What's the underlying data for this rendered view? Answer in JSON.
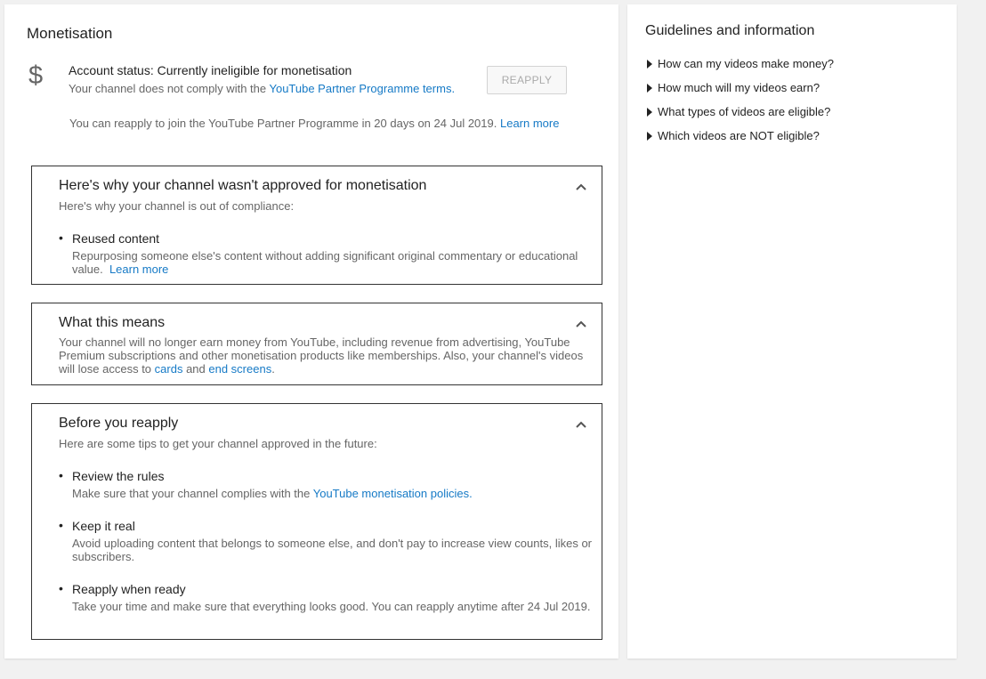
{
  "page": {
    "title": "Monetisation"
  },
  "status": {
    "icon": "dollar-icon",
    "icon_glyph": "$",
    "line": "Account status: Currently ineligible for monetisation",
    "sub_prefix": "Your channel does not comply with the ",
    "sub_link": "YouTube Partner Programme terms.",
    "reapply_label": "REAPPLY",
    "note_prefix": "You can reapply to join the YouTube Partner Programme in 20 days on 24 Jul 2019. ",
    "note_link": "Learn more"
  },
  "why": {
    "heading": "Here's why your channel wasn't approved for monetisation",
    "sub": "Here's why your channel is out of compliance:",
    "item_title": "Reused content",
    "item_desc": "Repurposing someone else's content without adding significant original commentary or educational value.",
    "item_link": "Learn more"
  },
  "means": {
    "heading": "What this means",
    "body_prefix": "Your channel will no longer earn money from YouTube, including revenue from advertising, YouTube Premium subscriptions and other monetisation products like memberships. Also, your channel's videos will lose access to ",
    "link_cards": "cards",
    "body_and": " and ",
    "link_end_screens": "end screens",
    "body_suffix": "."
  },
  "before": {
    "heading": "Before you reapply",
    "sub": "Here are some tips to get your channel approved in the future:",
    "items": [
      {
        "title": "Review the rules",
        "desc_prefix": "Make sure that your channel complies with the ",
        "desc_link": "YouTube monetisation policies."
      },
      {
        "title": "Keep it real",
        "desc": "Avoid uploading content that belongs to someone else, and don't pay to increase view counts, likes or subscribers."
      },
      {
        "title": "Reapply when ready",
        "desc": "Take your time and make sure that everything looks good. You can reapply anytime after 24 Jul 2019."
      }
    ]
  },
  "sidebar": {
    "title": "Guidelines and information",
    "items": [
      {
        "label": "How can my videos make money?"
      },
      {
        "label": "How much will my videos earn?"
      },
      {
        "label": "What types of videos are eligible?"
      },
      {
        "label": "Which videos are NOT eligible?"
      }
    ]
  },
  "colors": {
    "link": "#167ac6",
    "background": "#f1f1f1",
    "card": "#ffffff"
  }
}
